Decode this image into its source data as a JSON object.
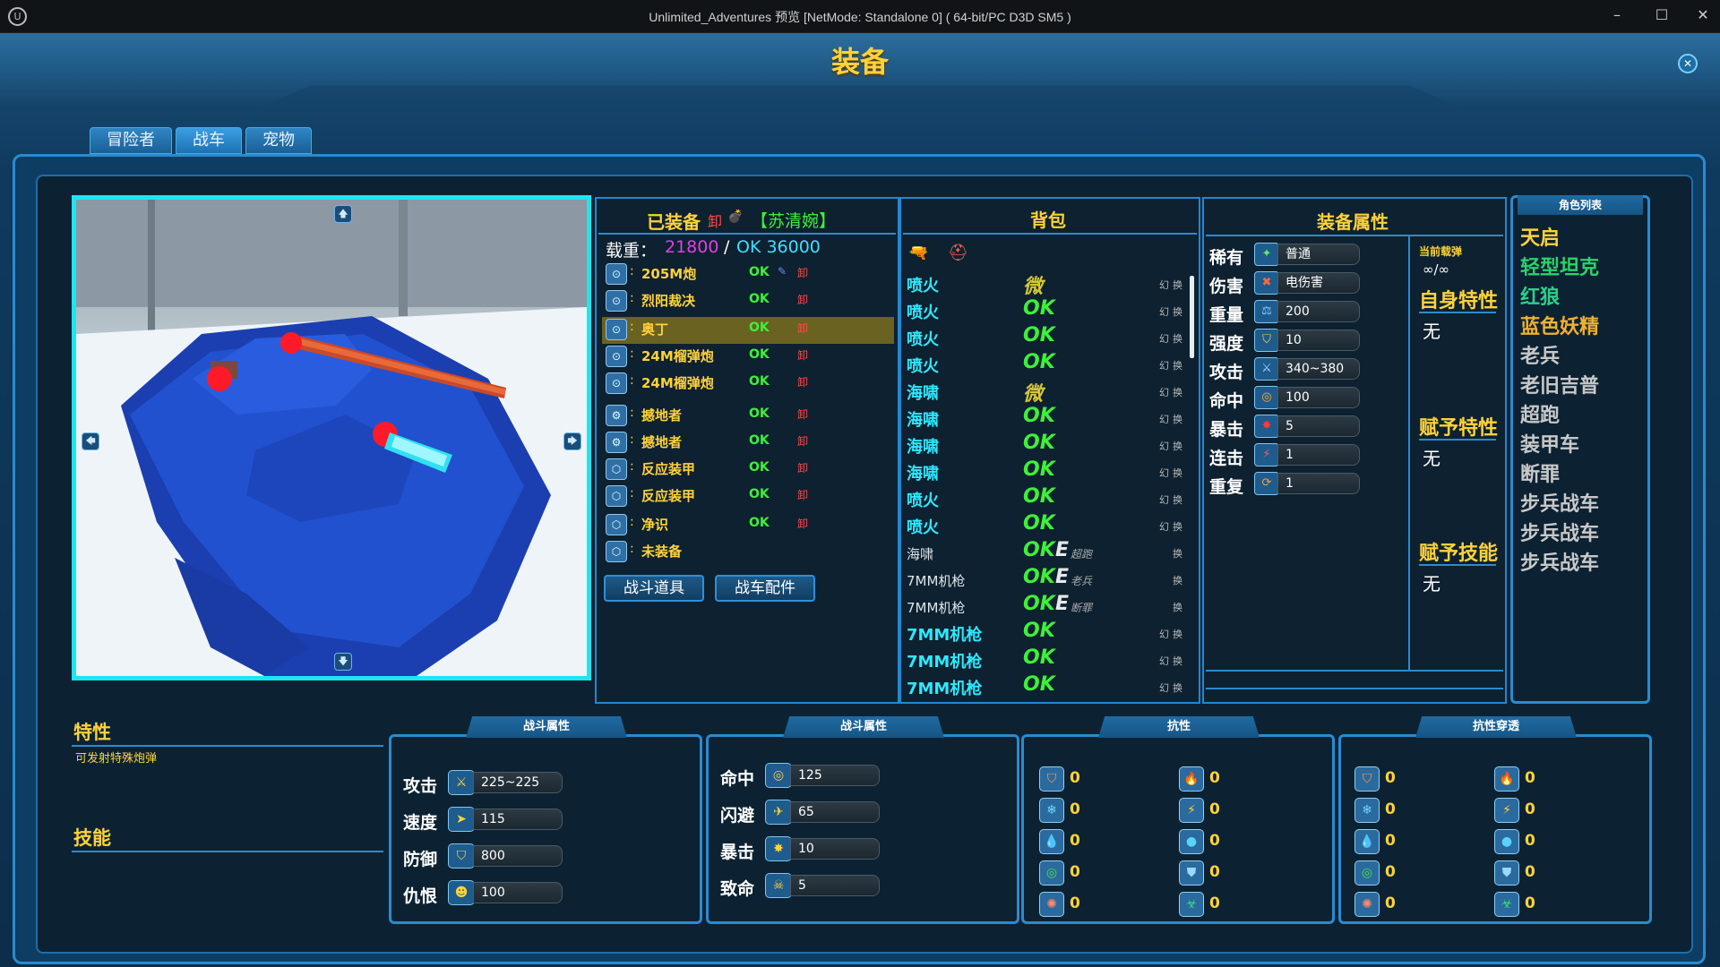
{
  "window": {
    "title": "Unlimited_Adventures 预览 [NetMode: Standalone 0]  ( 64-bit/PC D3D SM5 )",
    "minimize": "–",
    "maximize": "☐",
    "close": "✕",
    "logo": "U"
  },
  "page": {
    "title": "装备",
    "close_icon": "✕"
  },
  "tabs": [
    {
      "label": "冒险者"
    },
    {
      "label": "战车"
    },
    {
      "label": "宠物"
    }
  ],
  "viewport": {
    "up": "🡅",
    "down": "🡇",
    "left": "🡄",
    "right": "🡆"
  },
  "equipped": {
    "header": "已装备",
    "unload": "卸",
    "potion_icon": "💣",
    "owner": "【苏清婉】",
    "load_label": "载重：",
    "load_value": "21800",
    "load_sep": "/",
    "load_limit": "OK 36000",
    "items": [
      {
        "name": "205M炮",
        "status": "OK",
        "wrench": "✎",
        "unload": "卸",
        "icon": "⊙"
      },
      {
        "name": "烈阳裁决",
        "status": "OK",
        "unload": "卸",
        "icon": "⊙"
      },
      {
        "name": "奥丁",
        "status": "OK",
        "unload": "卸",
        "icon": "⊙"
      },
      {
        "name": "24M榴弹炮",
        "status": "OK",
        "unload": "卸",
        "icon": "⊙"
      },
      {
        "name": "24M榴弹炮",
        "status": "OK",
        "unload": "卸",
        "icon": "⊙"
      },
      {
        "name": "撼地者",
        "status": "OK",
        "unload": "卸",
        "icon": "⚙"
      },
      {
        "name": "撼地者",
        "status": "OK",
        "unload": "卸",
        "icon": "⚙"
      },
      {
        "name": "反应装甲",
        "status": "OK",
        "unload": "卸",
        "icon": "⬡"
      },
      {
        "name": "反应装甲",
        "status": "OK",
        "unload": "卸",
        "icon": "⬡"
      },
      {
        "name": "净识",
        "status": "OK",
        "unload": "卸",
        "icon": "⬡"
      },
      {
        "name": "未装备",
        "status": "",
        "unload": "",
        "icon": "⬡"
      }
    ],
    "btn_combat_items": "战斗道具",
    "btn_tank_parts": "战车配件"
  },
  "backpack": {
    "header": "背包",
    "filter1": "🔫",
    "filter2": "⛑",
    "items": [
      {
        "name": "喷火",
        "status": "微",
        "extra": "",
        "extra_text": "",
        "h": "幻",
        "c": "换"
      },
      {
        "name": "喷火",
        "status": "OK",
        "extra": "",
        "extra_text": "",
        "h": "幻",
        "c": "换"
      },
      {
        "name": "喷火",
        "status": "OK",
        "extra": "",
        "extra_text": "",
        "h": "幻",
        "c": "换"
      },
      {
        "name": "喷火",
        "status": "OK",
        "extra": "",
        "extra_text": "",
        "h": "幻",
        "c": "换"
      },
      {
        "name": "海啸",
        "status": "微",
        "extra": "",
        "extra_text": "",
        "h": "幻",
        "c": "换"
      },
      {
        "name": "海啸",
        "status": "OK",
        "extra": "",
        "extra_text": "",
        "h": "幻",
        "c": "换"
      },
      {
        "name": "海啸",
        "status": "OK",
        "extra": "",
        "extra_text": "",
        "h": "幻",
        "c": "换"
      },
      {
        "name": "海啸",
        "status": "OK",
        "extra": "",
        "extra_text": "",
        "h": "幻",
        "c": "换"
      },
      {
        "name": "喷火",
        "status": "OK",
        "extra": "",
        "extra_text": "",
        "h": "幻",
        "c": "换"
      },
      {
        "name": "喷火",
        "status": "OK",
        "extra": "",
        "extra_text": "",
        "h": "幻",
        "c": "换"
      },
      {
        "name": "海啸",
        "status": "OK",
        "extra": "E",
        "extra_text": "超跑",
        "h": "",
        "c": "换"
      },
      {
        "name": "7MM机枪",
        "status": "OK",
        "extra": "E",
        "extra_text": "老兵",
        "h": "",
        "c": "换"
      },
      {
        "name": "7MM机枪",
        "status": "OK",
        "extra": "E",
        "extra_text": "断罪",
        "h": "",
        "c": "换"
      },
      {
        "name": "7MM机枪",
        "status": "OK",
        "extra": "",
        "extra_text": "",
        "h": "幻",
        "c": "换"
      },
      {
        "name": "7MM机枪",
        "status": "OK",
        "extra": "",
        "extra_text": "",
        "h": "幻",
        "c": "换"
      },
      {
        "name": "7MM机枪",
        "status": "OK",
        "extra": "",
        "extra_text": "",
        "h": "幻",
        "c": "换"
      }
    ]
  },
  "attributes": {
    "header": "装备属性",
    "rows": [
      {
        "label": "稀有",
        "icon": "✦",
        "value": "普通"
      },
      {
        "label": "伤害",
        "icon": "✖",
        "value": "电伤害"
      },
      {
        "label": "重量",
        "icon": "⚖",
        "value": "200"
      },
      {
        "label": "强度",
        "icon": "⛉",
        "value": "10"
      },
      {
        "label": "攻击",
        "icon": "⚔",
        "value": "340~380"
      },
      {
        "label": "命中",
        "icon": "◎",
        "value": "100"
      },
      {
        "label": "暴击",
        "icon": "✸",
        "value": "5"
      },
      {
        "label": "连击",
        "icon": "⚡",
        "value": "1"
      },
      {
        "label": "重复",
        "icon": "⟳",
        "value": "1"
      }
    ],
    "ammo_label": "当前载弹",
    "ammo_value": "∞/∞",
    "self_trait": "自身特性",
    "self_trait_value": "无",
    "grant_trait": "赋予特性",
    "grant_trait_value": "无",
    "grant_skill": "赋予技能",
    "grant_skill_value": "无"
  },
  "roles": {
    "header": "角色列表",
    "items": [
      {
        "name": "天启",
        "color": "#ffd23a"
      },
      {
        "name": "轻型坦克",
        "color": "#2cd26b"
      },
      {
        "name": "红狼",
        "color": "#2ecf8a"
      },
      {
        "name": "蓝色妖精",
        "color": "#f0b030"
      },
      {
        "name": "老兵",
        "color": "#c8c8c8"
      },
      {
        "name": "老旧吉普",
        "color": "#c8c8c8"
      },
      {
        "name": "超跑",
        "color": "#c8c8c8"
      },
      {
        "name": "装甲车",
        "color": "#c8c8c8"
      },
      {
        "name": "断罪",
        "color": "#c8c8c8"
      },
      {
        "name": "步兵战车",
        "color": "#c8c8c8"
      },
      {
        "name": "步兵战车",
        "color": "#c8c8c8"
      },
      {
        "name": "步兵战车",
        "color": "#c8c8c8"
      }
    ]
  },
  "trait": {
    "label": "特性",
    "desc": "可发射特殊炮弹",
    "skill_label": "技能"
  },
  "combat1": {
    "header": "战斗属性",
    "rows": [
      {
        "label": "攻击",
        "icon": "⚔",
        "value": "225~225"
      },
      {
        "label": "速度",
        "icon": "➤",
        "value": "115"
      },
      {
        "label": "防御",
        "icon": "⛉",
        "value": "800"
      },
      {
        "label": "仇恨",
        "icon": "☻",
        "value": "100"
      }
    ]
  },
  "combat2": {
    "header": "战斗属性",
    "rows": [
      {
        "label": "命中",
        "icon": "◎",
        "value": "125"
      },
      {
        "label": "闪避",
        "icon": "✈",
        "value": "65"
      },
      {
        "label": "暴击",
        "icon": "✸",
        "value": "10"
      },
      {
        "label": "致命",
        "icon": "☠",
        "value": "5"
      }
    ]
  },
  "resist": {
    "header": "抗性",
    "items": [
      {
        "icon": "⛉",
        "value": "0",
        "color": "#ff9c3a"
      },
      {
        "icon": "🔥",
        "value": "0",
        "color": "#ff4a2a"
      },
      {
        "icon": "❄",
        "value": "0",
        "color": "#6cd4ff"
      },
      {
        "icon": "⚡",
        "value": "0",
        "color": "#ffd23a"
      },
      {
        "icon": "💧",
        "value": "0",
        "color": "#c040c0"
      },
      {
        "icon": "●",
        "value": "0",
        "color": "#5ad2ff"
      },
      {
        "icon": "◎",
        "value": "0",
        "color": "#4ae04a"
      },
      {
        "icon": "⛊",
        "value": "0",
        "color": "#9ad8ff"
      },
      {
        "icon": "✺",
        "value": "0",
        "color": "#ff8a6a"
      },
      {
        "icon": "☣",
        "value": "0",
        "color": "#3ae06a"
      }
    ]
  },
  "pierce": {
    "header": "抗性穿透",
    "items": [
      {
        "icon": "⛉",
        "value": "0",
        "color": "#ff9c3a"
      },
      {
        "icon": "🔥",
        "value": "0",
        "color": "#ff4a2a"
      },
      {
        "icon": "❄",
        "value": "0",
        "color": "#6cd4ff"
      },
      {
        "icon": "⚡",
        "value": "0",
        "color": "#ffd23a"
      },
      {
        "icon": "💧",
        "value": "0",
        "color": "#c040c0"
      },
      {
        "icon": "●",
        "value": "0",
        "color": "#5ad2ff"
      },
      {
        "icon": "◎",
        "value": "0",
        "color": "#4ae04a"
      },
      {
        "icon": "⛊",
        "value": "0",
        "color": "#9ad8ff"
      },
      {
        "icon": "✺",
        "value": "0",
        "color": "#ff8a6a"
      },
      {
        "icon": "☣",
        "value": "0",
        "color": "#3ae06a"
      }
    ]
  }
}
